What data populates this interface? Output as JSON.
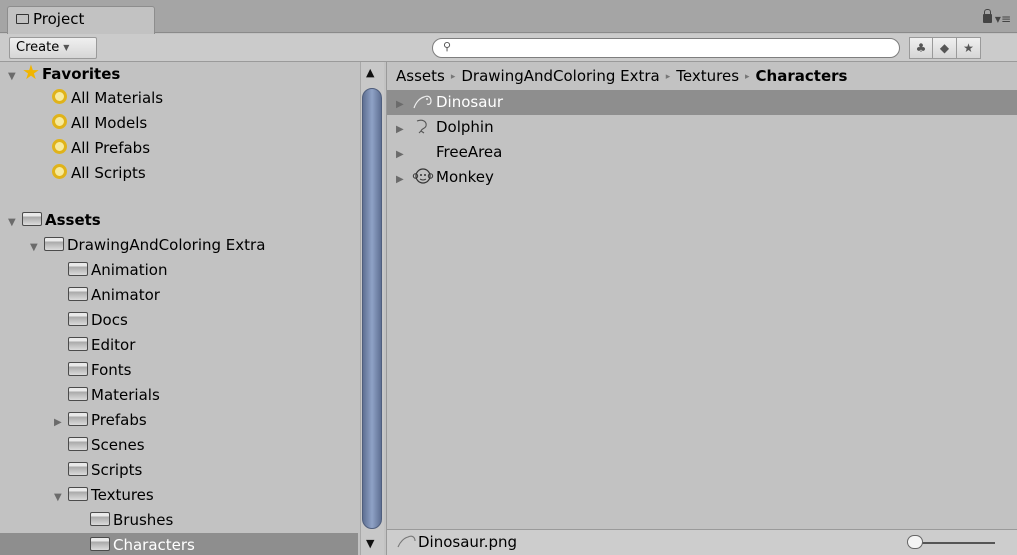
{
  "window": {
    "tab_title": "Project",
    "menu_glyph": "▾≡"
  },
  "toolbar": {
    "create_label": "Create",
    "create_caret": "▼",
    "search_placeholder": "",
    "search_icon": "magnifier-icon",
    "buttons": [
      {
        "icon": "filter-by-type-icon",
        "glyph": "♣"
      },
      {
        "icon": "filter-by-label-icon",
        "glyph": "◆"
      },
      {
        "icon": "favorite-star-icon",
        "glyph": "★"
      }
    ]
  },
  "tree": {
    "favorites": {
      "label": "Favorites",
      "items": [
        "All Materials",
        "All Models",
        "All Prefabs",
        "All Scripts"
      ]
    },
    "assets": {
      "label": "Assets",
      "root": "DrawingAndColoring Extra",
      "folders": [
        {
          "label": "Animation",
          "arrow": ""
        },
        {
          "label": "Animator",
          "arrow": ""
        },
        {
          "label": "Docs",
          "arrow": ""
        },
        {
          "label": "Editor",
          "arrow": ""
        },
        {
          "label": "Fonts",
          "arrow": ""
        },
        {
          "label": "Materials",
          "arrow": ""
        },
        {
          "label": "Prefabs",
          "arrow": "▶"
        },
        {
          "label": "Scenes",
          "arrow": ""
        },
        {
          "label": "Scripts",
          "arrow": ""
        },
        {
          "label": "Textures",
          "arrow": "▼"
        }
      ],
      "texture_children": [
        "Brushes",
        "Characters"
      ],
      "selected": "Characters"
    }
  },
  "breadcrumb": {
    "parts": [
      "Assets",
      "DrawingAndColoring Extra",
      "Textures"
    ],
    "current": "Characters",
    "separator": "▸"
  },
  "files": [
    {
      "name": "Dinosaur",
      "selected": true,
      "has_arrow": true
    },
    {
      "name": "Dolphin",
      "selected": false,
      "has_arrow": true
    },
    {
      "name": "FreeArea",
      "selected": false,
      "has_arrow": true
    },
    {
      "name": "Monkey",
      "selected": false,
      "has_arrow": true
    }
  ],
  "status": {
    "selected_file": "Dinosaur.png"
  },
  "zoom_slider": {
    "value": 0.0
  }
}
